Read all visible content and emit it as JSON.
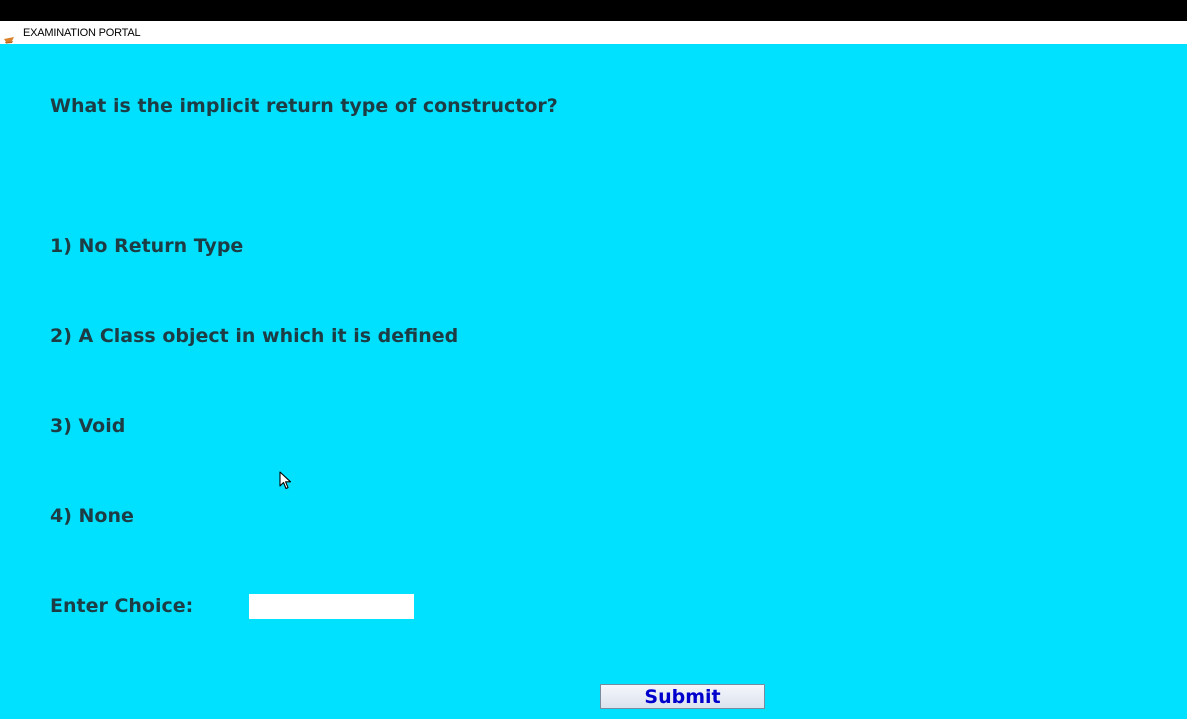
{
  "window": {
    "title": "EXAMINATION PORTAL",
    "icon": "java-cup-icon"
  },
  "quiz": {
    "question": "What is the implicit return type of constructor?",
    "options": [
      "1) No Return Type",
      "2) A Class object in which it is defined",
      "3) Void",
      "4) None"
    ],
    "choice_label": "Enter Choice:",
    "choice_value": "",
    "submit_label": "Submit"
  },
  "colors": {
    "background": "#00e1ff",
    "text": "#1d3c44",
    "submit_text": "#0000cc"
  }
}
